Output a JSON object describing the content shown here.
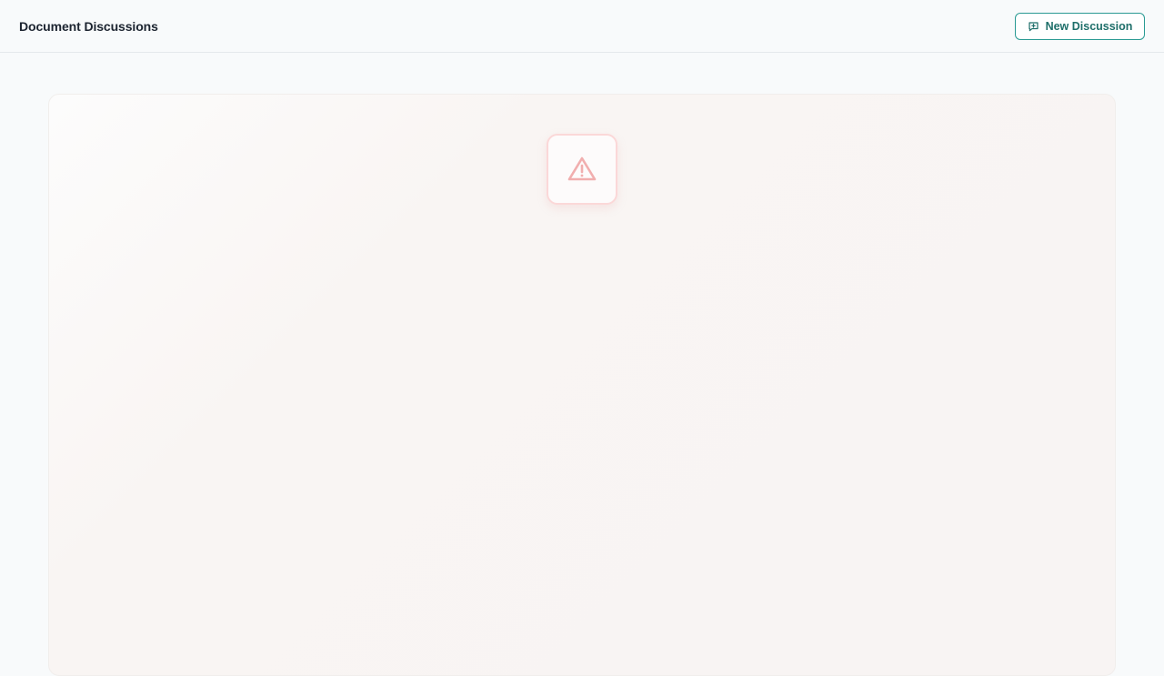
{
  "header": {
    "title": "Document Discussions",
    "new_discussion_label": "New Discussion",
    "new_discussion_icon": "message-plus-icon"
  },
  "main": {
    "status_icon": "warning-triangle-icon"
  },
  "colors": {
    "accent": "#2a9a93",
    "accent_text": "#1f6f6a",
    "warning": "#f1aeae",
    "background": "#f8fafb"
  }
}
